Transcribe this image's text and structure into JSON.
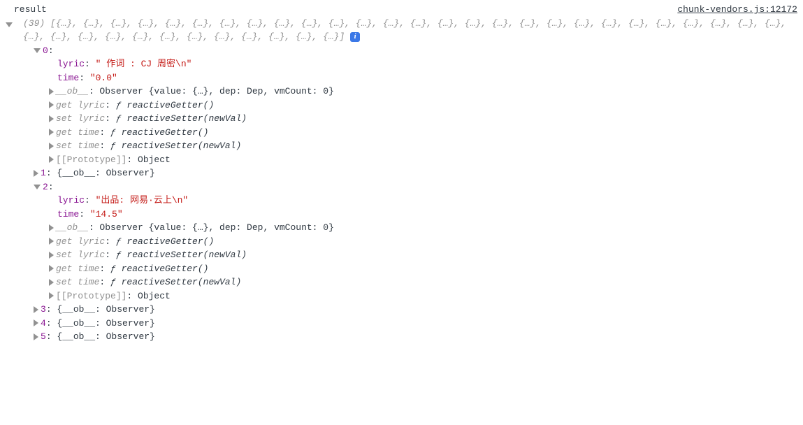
{
  "header": {
    "label": "result",
    "sourceLink": "chunk-vendors.js:12172"
  },
  "preview": {
    "count": "(39)",
    "items": "[{…}, {…}, {…}, {…}, {…}, {…}, {…}, {…}, {…}, {…}, {…}, {…}, {…}, {…}, {…}, {…}, {…}, {…}, {…}, {…}, {…}, {…}, {…}, {…}, {…}, {…}, {…}, {…}, {…}, {…}, {…}, {…}, {…}, {…}, {…}, {…}, {…}, {…}, {…}]"
  },
  "entries": {
    "idx0": {
      "key": "0",
      "lyricKey": "lyric",
      "lyricVal": "\" 作词 : CJ 周密\\n\"",
      "timeKey": "time",
      "timeVal": "\"0.0\"",
      "obKey": "__ob__",
      "obVal": "Observer {value: {…}, dep: Dep, vmCount: 0}",
      "getLyricKey": "get lyric",
      "getLyricVal": "ƒ reactiveGetter()",
      "setLyricKey": "set lyric",
      "setLyricVal": "ƒ reactiveSetter(newVal)",
      "getTimeKey": "get time",
      "getTimeVal": "ƒ reactiveGetter()",
      "setTimeKey": "set time",
      "setTimeVal": "ƒ reactiveSetter(newVal)",
      "protoKey": "[[Prototype]]",
      "protoVal": "Object"
    },
    "idx1": {
      "key": "1",
      "preview": "{__ob__: Observer}"
    },
    "idx2": {
      "key": "2",
      "lyricKey": "lyric",
      "lyricVal": "\"出品: 网易·云上\\n\"",
      "timeKey": "time",
      "timeVal": "\"14.5\"",
      "obKey": "__ob__",
      "obVal": "Observer {value: {…}, dep: Dep, vmCount: 0}",
      "getLyricKey": "get lyric",
      "getLyricVal": "ƒ reactiveGetter()",
      "setLyricKey": "set lyric",
      "setLyricVal": "ƒ reactiveSetter(newVal)",
      "getTimeKey": "get time",
      "getTimeVal": "ƒ reactiveGetter()",
      "setTimeKey": "set time",
      "setTimeVal": "ƒ reactiveSetter(newVal)",
      "protoKey": "[[Prototype]]",
      "protoVal": "Object"
    },
    "idx3": {
      "key": "3",
      "preview": "{__ob__: Observer}"
    },
    "idx4": {
      "key": "4",
      "preview": "{__ob__: Observer}"
    },
    "idx5": {
      "key": "5",
      "preview": "{__ob__: Observer}"
    }
  },
  "labels": {
    "colon": ": ",
    "f_sym": "ƒ "
  }
}
